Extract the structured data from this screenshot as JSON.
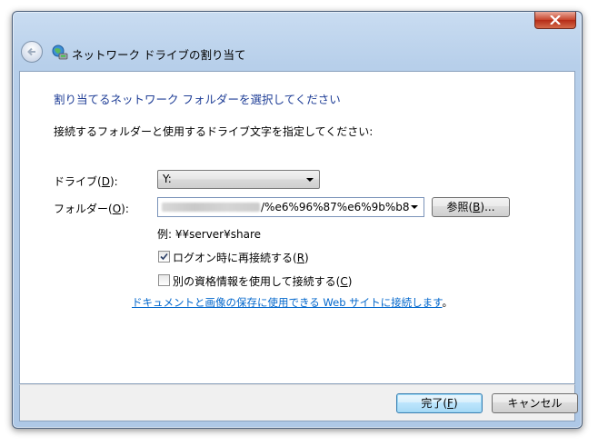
{
  "window": {
    "title": "ネットワーク ドライブの割り当て",
    "close_glyph": "✕"
  },
  "main": {
    "instruction": "割り当てるネットワーク フォルダーを選択してください",
    "subtext": "接続するフォルダーと使用するドライブ文字を指定してください:",
    "drive_label": "ドライブ(",
    "drive_label_key": "D",
    "drive_label_end": "):",
    "drive_value": "Y:",
    "folder_label": "フォルダー(",
    "folder_label_key": "O",
    "folder_label_end": "):",
    "folder_value": "/%e6%96%87%e6%9b%b8",
    "browse_label": "参照(",
    "browse_key": "B",
    "browse_end": ")...",
    "example": "例: ¥¥server¥share",
    "reconnect_label": "ログオン時に再接続する(",
    "reconnect_key": "R",
    "reconnect_end": ")",
    "reconnect_checked": true,
    "other_creds_label": "別の資格情報を使用して接続する(",
    "other_creds_key": "C",
    "other_creds_end": ")",
    "other_creds_checked": false,
    "link_text": "ドキュメントと画像の保存に使用できる Web サイトに接続します",
    "link_suffix": "。"
  },
  "footer": {
    "finish_label": "完了(",
    "finish_key": "F",
    "finish_end": ")",
    "cancel_label": "キャンセル"
  },
  "colors": {
    "instruction": "#1e3d96",
    "link": "#0066cc",
    "close_button": "#c7432b"
  },
  "icons": [
    "back-arrow-icon",
    "network-drive-icon",
    "close-icon",
    "chevron-down-icon",
    "checkmark-icon"
  ]
}
